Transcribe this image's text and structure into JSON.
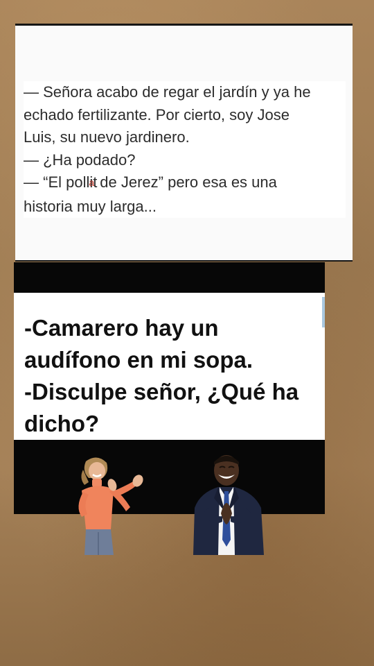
{
  "joke1": {
    "lines": [
      "— Señora acabo de regar el jardín y ya he",
      "echado fertilizante. Por cierto, soy Jose",
      "Luis, su nuevo jardinero.",
      "— ¿Ha podado?",
      "— “El pollit",
      " de Jerez” pero esa es una",
      "historia muy larga..."
    ],
    "correction_mark": "a"
  },
  "joke2": {
    "lines": [
      "-Camarero hay un",
      "audífono en mi sopa.",
      "-Disculpe señor, ¿Qué ha",
      "dicho?"
    ]
  },
  "stickers": {
    "left": "clapping-woman",
    "right": "laughing-man-in-suit"
  }
}
